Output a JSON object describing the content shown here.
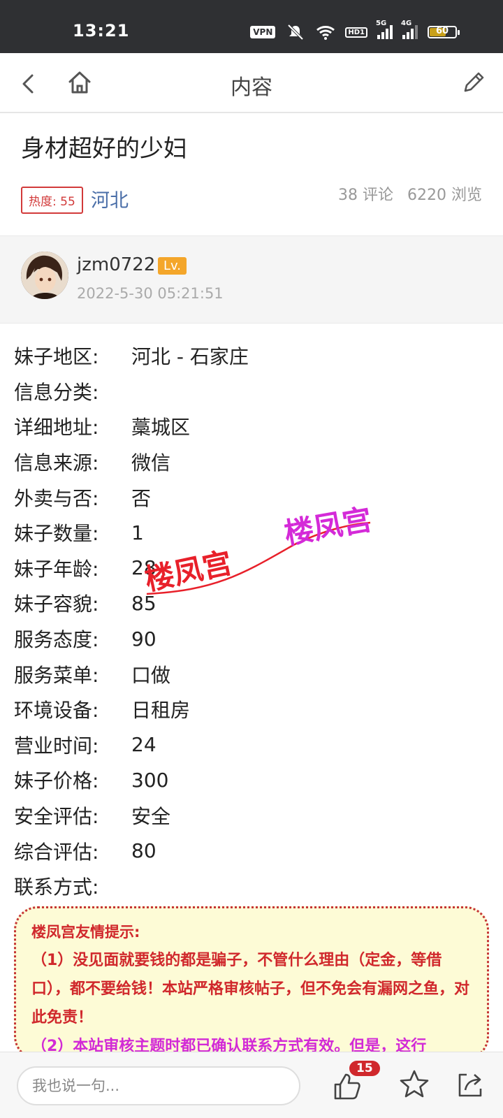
{
  "status_bar": {
    "time": "13:21",
    "vpn": "VPN",
    "hd": "HD1",
    "net1": "5G",
    "net2": "4G",
    "battery": "60"
  },
  "nav": {
    "title": "内容"
  },
  "post": {
    "title": "身材超好的少妇",
    "heat": "热度: 55",
    "region": "河北",
    "comments": "38 评论",
    "views": "6220 浏览"
  },
  "author": {
    "name": "jzm0722",
    "level": "Lv.",
    "time": "2022-5-30 05:21:51"
  },
  "info": [
    {
      "label": "妹子地区:",
      "value": "河北 - 石家庄"
    },
    {
      "label": "信息分类:",
      "value": ""
    },
    {
      "label": "详细地址:",
      "value": "藁城区"
    },
    {
      "label": "信息来源:",
      "value": "微信"
    },
    {
      "label": "外卖与否:",
      "value": "否"
    },
    {
      "label": "妹子数量:",
      "value": "1"
    },
    {
      "label": "妹子年龄:",
      "value": "28"
    },
    {
      "label": "妹子容貌:",
      "value": "85"
    },
    {
      "label": "服务态度:",
      "value": "90"
    },
    {
      "label": "服务菜单:",
      "value": "口做"
    },
    {
      "label": "环境设备:",
      "value": "日租房"
    },
    {
      "label": "营业时间:",
      "value": "24"
    },
    {
      "label": "妹子价格:",
      "value": "300"
    },
    {
      "label": "安全评估:",
      "value": "安全"
    },
    {
      "label": "综合评估:",
      "value": "80"
    },
    {
      "label": "联系方式:",
      "value": ""
    }
  ],
  "watermark": {
    "text1": "楼凤宫",
    "text2": "楼凤宫"
  },
  "notice": {
    "title": "楼凤宫友情提示:",
    "p1": "（1）没见面就要钱的都是骗子，不管什么理由（定金，等借口），都不要给钱！本站严格审核帖子，但不免会有漏网之鱼，对此免责！",
    "p2": "（2）本站审核主题时都已确认联系方式有效。但是，这行"
  },
  "bottom": {
    "placeholder": "我也说一句...",
    "like_count": "15"
  },
  "colors": {
    "heat": "#d23a3a",
    "region": "#4a6ea8",
    "level": "#f4a62a",
    "notice_red": "#d0282c",
    "notice_pink": "#d22ad6"
  }
}
